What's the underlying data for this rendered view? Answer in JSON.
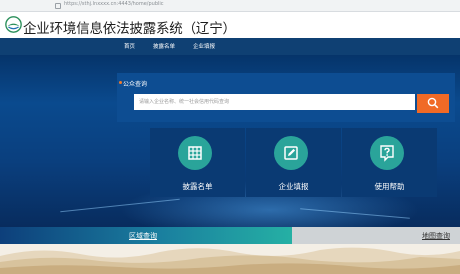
{
  "browser": {
    "url": "https://sthj.lnxxxx.cn:4443/home/public"
  },
  "header": {
    "title": "企业环境信息依法披露系统（辽宁）"
  },
  "nav": {
    "items": [
      {
        "label": "首页"
      },
      {
        "label": "披露名单"
      },
      {
        "label": "企业填报"
      }
    ]
  },
  "search": {
    "title": "公众查询",
    "placeholder": "请输入企业名称、统一社会信用代码查询"
  },
  "tiles": [
    {
      "label": "披露名单",
      "icon": "table-icon"
    },
    {
      "label": "企业填报",
      "icon": "edit-icon"
    },
    {
      "label": "使用帮助",
      "icon": "help-icon"
    }
  ],
  "tabs": {
    "left": "区域查询",
    "right": "地图查询"
  },
  "colors": {
    "nav": "#0f4073",
    "accent": "#f06a26",
    "teal": "#2aa49a"
  }
}
